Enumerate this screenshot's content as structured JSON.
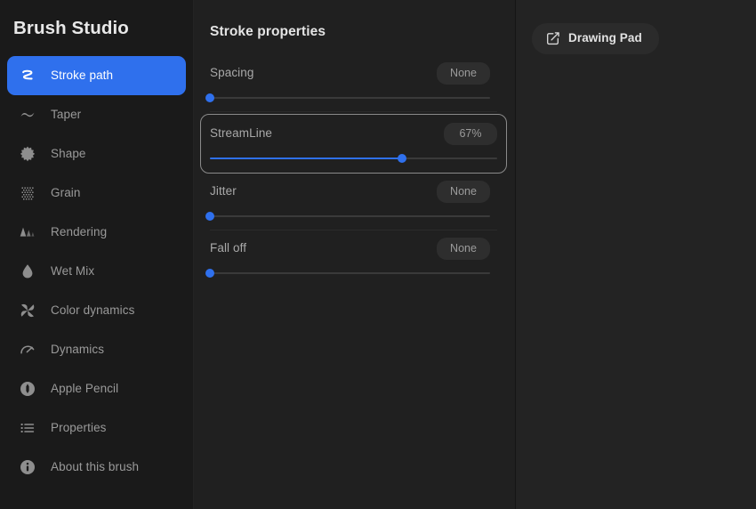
{
  "app": {
    "title": "Brush Studio"
  },
  "theme": {
    "accent": "#2f70ed",
    "sidebar_bg": "#1a1a1a",
    "panel_bg": "#202020",
    "right_bg": "#232323",
    "pill_bg": "#2e2e2e",
    "text_primary": "#e8e8e8",
    "text_muted": "#9a9a9a"
  },
  "sidebar": {
    "items": [
      {
        "label": "Stroke path",
        "icon": "stroke-path-icon",
        "active": true
      },
      {
        "label": "Taper",
        "icon": "taper-wave-icon",
        "active": false
      },
      {
        "label": "Shape",
        "icon": "shape-starburst-icon",
        "active": false
      },
      {
        "label": "Grain",
        "icon": "grain-dots-icon",
        "active": false
      },
      {
        "label": "Rendering",
        "icon": "rendering-layers-icon",
        "active": false
      },
      {
        "label": "Wet Mix",
        "icon": "droplet-icon",
        "active": false
      },
      {
        "label": "Color dynamics",
        "icon": "pinwheel-icon",
        "active": false
      },
      {
        "label": "Dynamics",
        "icon": "gauge-icon",
        "active": false
      },
      {
        "label": "Apple Pencil",
        "icon": "apple-pencil-icon",
        "active": false
      },
      {
        "label": "Properties",
        "icon": "list-icon",
        "active": false
      },
      {
        "label": "About this brush",
        "icon": "info-icon",
        "active": false
      }
    ]
  },
  "main": {
    "title": "Stroke properties",
    "sliders": [
      {
        "label": "Spacing",
        "value_text": "None",
        "percent": 0,
        "highlighted": false
      },
      {
        "label": "StreamLine",
        "value_text": "67%",
        "percent": 67,
        "highlighted": true
      },
      {
        "label": "Jitter",
        "value_text": "None",
        "percent": 0,
        "highlighted": false
      },
      {
        "label": "Fall off",
        "value_text": "None",
        "percent": 0,
        "highlighted": false
      }
    ]
  },
  "right": {
    "drawing_pad_label": "Drawing Pad",
    "drawing_pad_icon": "edit-square-icon"
  }
}
